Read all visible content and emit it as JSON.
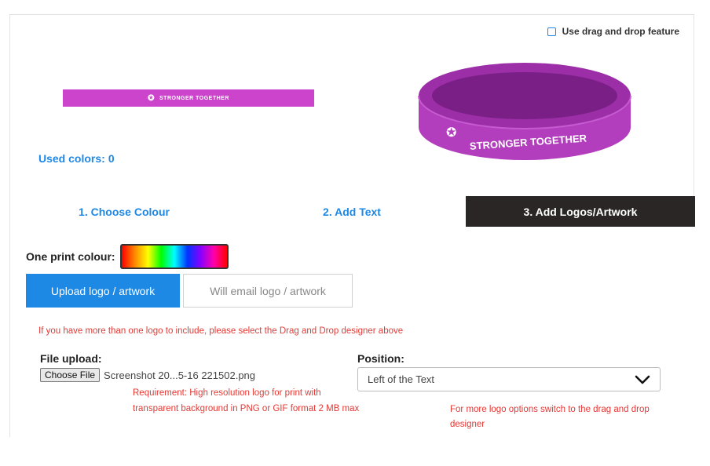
{
  "preview": {
    "drag_drop_label": "Use drag and drop feature",
    "band_text": "STRONGER TOGETHER",
    "used_colors_label": "Used colors:",
    "used_colors_count": "0",
    "band_color": "#cc44cc"
  },
  "tabs": [
    {
      "label": "1. Choose Colour",
      "active": false
    },
    {
      "label": "2. Add Text",
      "active": false
    },
    {
      "label": "3. Add Logos/Artwork",
      "active": true
    }
  ],
  "artwork": {
    "print_colour_label": "One print colour:",
    "upload_button": "Upload logo / artwork",
    "email_button": "Will email logo / artwork",
    "multi_logo_note": "If you have more than one logo to include, please select the Drag and Drop designer above",
    "file_upload_label": "File upload:",
    "choose_file_button": "Choose File",
    "file_name": "Screenshot 20...5-16 221502.png",
    "requirement_note": "Requirement: High resolution logo for print with transparent background in PNG or GIF format 2 MB max",
    "position_label": "Position:",
    "position_value": "Left of the Text",
    "position_note": "For more logo options switch to the drag and drop designer"
  },
  "colors": {
    "accent": "#1e88e5",
    "dark_tab": "#2a2626",
    "warning": "#e53935",
    "band": "#cc44cc"
  }
}
